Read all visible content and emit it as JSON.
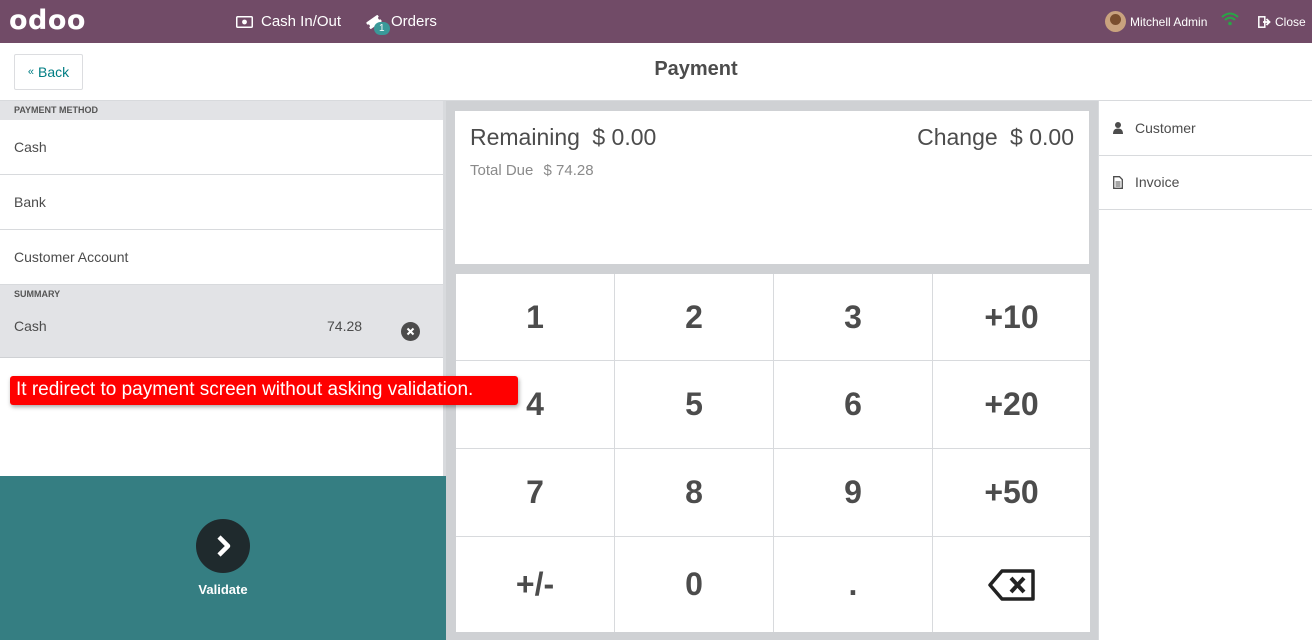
{
  "topbar": {
    "logo": "odoo",
    "cash_in_out": "Cash In/Out",
    "orders": "Orders",
    "orders_badge": "1",
    "user": "Mitchell Admin",
    "close": "Close"
  },
  "header": {
    "back": "Back",
    "title": "Payment"
  },
  "payment_methods": {
    "heading": "PAYMENT METHOD",
    "items": [
      {
        "label": "Cash"
      },
      {
        "label": "Bank"
      },
      {
        "label": "Customer Account"
      }
    ]
  },
  "summary": {
    "heading": "SUMMARY",
    "lines": [
      {
        "method": "Cash",
        "amount": "74.28"
      }
    ]
  },
  "annotation": "It redirect to payment screen without asking validation.",
  "validate": {
    "label": "Validate"
  },
  "status": {
    "remaining_label": "Remaining",
    "remaining_value": "$ 0.00",
    "change_label": "Change",
    "change_value": "$ 0.00",
    "due_label": "Total Due",
    "due_value": "$ 74.28"
  },
  "numpad": {
    "keys": [
      "1",
      "2",
      "3",
      "+10",
      "4",
      "5",
      "6",
      "+20",
      "7",
      "8",
      "9",
      "+50",
      "+/-",
      "0",
      "."
    ]
  },
  "right_panel": {
    "customer": "Customer",
    "invoice": "Invoice"
  },
  "colors": {
    "topbar": "#714b67",
    "validate_bg": "#357e82",
    "accent": "#017e84",
    "annotation_bg": "#ff0000",
    "wifi": "#28a745"
  },
  "icons": {
    "cash": "money-icon",
    "orders": "ticket-icon",
    "wifi": "wifi-icon",
    "close": "sign-out-icon",
    "back": "double-chevron-left-icon",
    "remove_line": "times-circle-icon",
    "validate": "chevron-right-icon",
    "backspace": "backspace-icon",
    "customer": "user-icon",
    "invoice": "file-icon"
  }
}
